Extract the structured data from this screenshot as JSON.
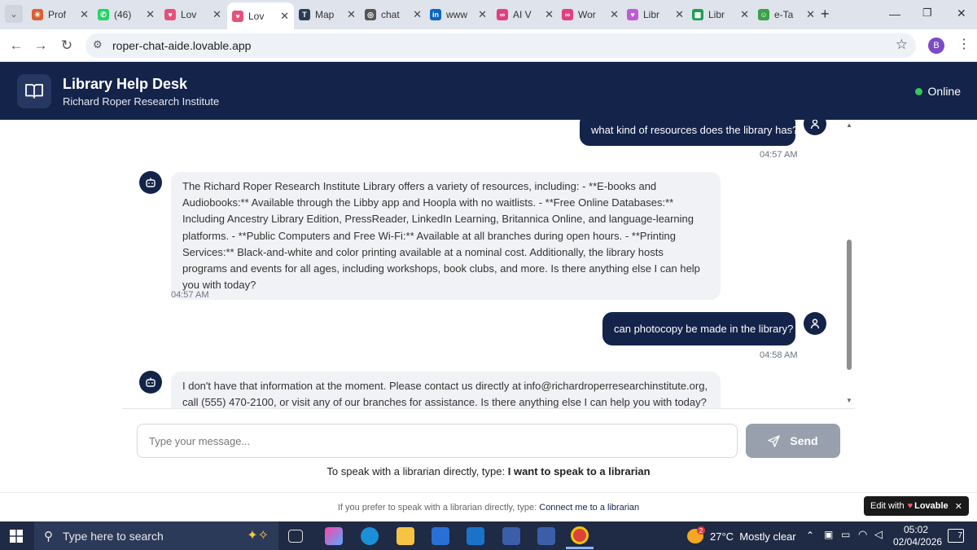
{
  "browser": {
    "tabs": [
      {
        "title": "Prof",
        "color": "#d9602f",
        "glyph": "✳"
      },
      {
        "title": "(46)",
        "color": "#25d366",
        "glyph": "✆"
      },
      {
        "title": "Lov",
        "color": "#e8507a",
        "glyph": "♥"
      },
      {
        "title": "Lov",
        "color": "#e8507a",
        "glyph": "♥"
      },
      {
        "title": "Map",
        "color": "#2d3b55",
        "glyph": "T"
      },
      {
        "title": "chat",
        "color": "#555555",
        "glyph": "◎"
      },
      {
        "title": "www",
        "color": "#0a66c2",
        "glyph": "in"
      },
      {
        "title": "AI V",
        "color": "#e04080",
        "glyph": "∞"
      },
      {
        "title": "Wor",
        "color": "#e04080",
        "glyph": "∞"
      },
      {
        "title": "Libr",
        "color": "#c05ad8",
        "glyph": "♥"
      },
      {
        "title": "Libr",
        "color": "#1f9d55",
        "glyph": "▦"
      },
      {
        "title": "e-Ta",
        "color": "#3aa14a",
        "glyph": "☺"
      }
    ],
    "close_glyph": "✕",
    "new_tab_glyph": "+",
    "url": "roper-chat-aide.lovable.app",
    "profile_initial": "B"
  },
  "header": {
    "title": "Library Help Desk",
    "subtitle": "Richard Roper Research Institute",
    "status": "Online",
    "status_color": "#34c759"
  },
  "messages": [
    {
      "role": "user",
      "text": "what kind of resources does the library has?",
      "time": "04:57 AM"
    },
    {
      "role": "bot",
      "text": "The Richard Roper Research Institute Library offers a variety of resources, including: - **E-books and Audiobooks:** Available through the Libby app and Hoopla with no waitlists. - **Free Online Databases:** Including Ancestry Library Edition, PressReader, LinkedIn Learning, Britannica Online, and language-learning platforms. - **Public Computers and Free Wi-Fi:** Available at all branches during open hours. - **Printing Services:** Black-and-white and color printing available at a nominal cost. Additionally, the library hosts programs and events for all ages, including workshops, book clubs, and more. Is there anything else I can help you with today?",
      "time": "04:57 AM"
    },
    {
      "role": "user",
      "text": "can photocopy be made in the library?",
      "time": "04:58 AM"
    },
    {
      "role": "bot",
      "text": "I don't have that information at the moment. Please contact us directly at info@richardroperresearchinstitute.org, call (555) 470-2100, or visit any of our branches for assistance. Is there anything else I can help you with today?",
      "time": ""
    }
  ],
  "composer": {
    "placeholder": "Type your message...",
    "send_label": "Send",
    "hint_prefix": "To speak with a librarian directly, type: ",
    "hint_command": "I want to speak to a librarian"
  },
  "footer": {
    "text_prefix": "If you prefer to speak with a librarian directly, type: ",
    "text_link": "Connect me to a librarian",
    "badge_prefix": "Edit with",
    "badge_brand": "Lovable",
    "badge_close": "✕"
  },
  "taskbar": {
    "search_placeholder": "Type here to search",
    "weather": "27°C  Mostly clear",
    "weather_badge": "2",
    "time": "05:02",
    "date": "02/04/2026",
    "notifications": "7"
  }
}
